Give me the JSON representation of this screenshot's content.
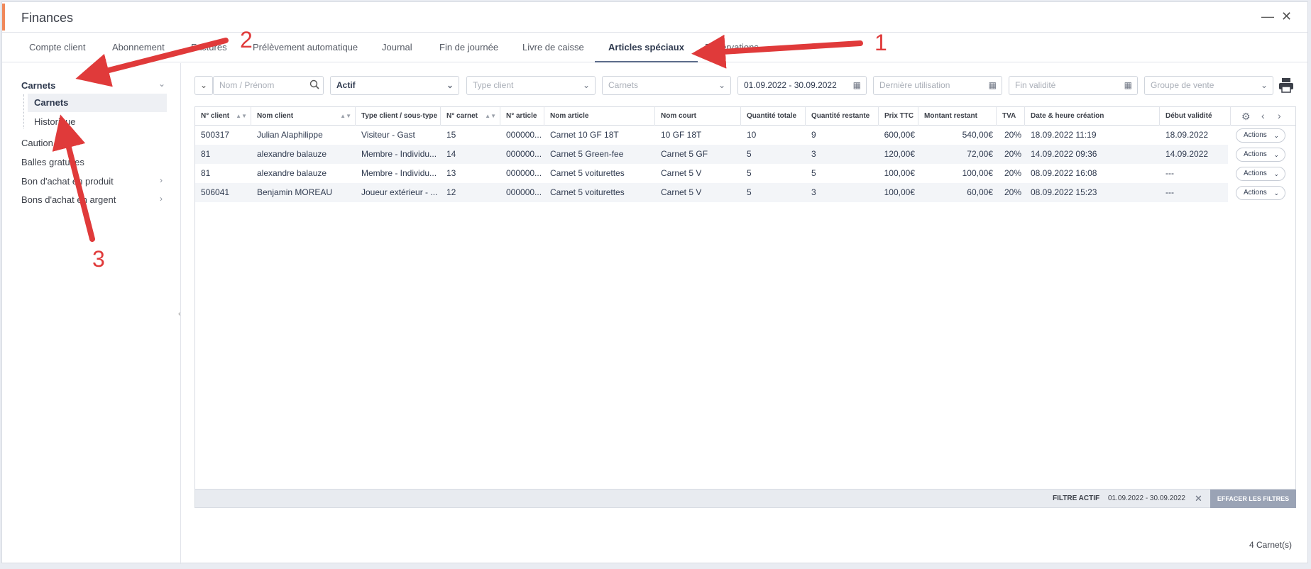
{
  "window": {
    "title": "Finances",
    "minimize_glyph": "—",
    "close_glyph": "✕"
  },
  "tabs": [
    {
      "label": "Compte client"
    },
    {
      "label": "Abonnement"
    },
    {
      "label": "Factures"
    },
    {
      "label": "Prélèvement automatique"
    },
    {
      "label": "Journal"
    },
    {
      "label": "Fin de journée"
    },
    {
      "label": "Livre de caisse"
    },
    {
      "label": "Articles spéciaux",
      "active": true
    },
    {
      "label": "Réservations"
    }
  ],
  "sidebar": {
    "group": "Carnets",
    "sub_items": [
      "Carnets",
      "Historique"
    ],
    "items": [
      "Caution",
      "Balles gratuites",
      "Bon d'achat en produit",
      "Bons d'achat en argent"
    ]
  },
  "filters": {
    "name_placeholder": "Nom / Prénom",
    "status": "Actif",
    "client_type_placeholder": "Type client",
    "carnets_placeholder": "Carnets",
    "date_range": "01.09.2022 - 30.09.2022",
    "last_use_placeholder": "Dernière utilisation",
    "validity_end_placeholder": "Fin validité",
    "sales_group_placeholder": "Groupe de vente"
  },
  "table": {
    "columns": [
      "N° client",
      "Nom client",
      "Type client / sous-type",
      "N° carnet",
      "N° article",
      "Nom article",
      "Nom court",
      "Quantité totale",
      "Quantité restante",
      "Prix TTC",
      "Montant restant",
      "TVA",
      "Date & heure création",
      "Début validité"
    ],
    "rows": [
      [
        "500317",
        "Julian Alaphilippe",
        "Visiteur - Gast",
        "15",
        "000000...",
        "Carnet 10 GF 18T",
        "10 GF 18T",
        "10",
        "9",
        "600,00€",
        "540,00€",
        "20%",
        "18.09.2022 11:19",
        "18.09.2022"
      ],
      [
        "81",
        "alexandre balauze",
        "Membre - Individu...",
        "14",
        "000000...",
        "Carnet 5 Green-fee",
        "Carnet 5 GF",
        "5",
        "3",
        "120,00€",
        "72,00€",
        "20%",
        "14.09.2022 09:36",
        "14.09.2022"
      ],
      [
        "81",
        "alexandre balauze",
        "Membre - Individu...",
        "13",
        "000000...",
        "Carnet 5 voiturettes",
        "Carnet 5 V",
        "5",
        "5",
        "100,00€",
        "100,00€",
        "20%",
        "08.09.2022 16:08",
        "---"
      ],
      [
        "506041",
        "Benjamin MOREAU",
        "Joueur extérieur - ...",
        "12",
        "000000...",
        "Carnet 5 voiturettes",
        "Carnet 5 V",
        "5",
        "3",
        "100,00€",
        "60,00€",
        "20%",
        "08.09.2022 15:23",
        "---"
      ]
    ],
    "action_label": "Actions"
  },
  "footer": {
    "filter_label": "FILTRE ACTIF",
    "filter_value": "01.09.2022 - 30.09.2022",
    "clear_button": "EFFACER LES FILTRES"
  },
  "count_text": "4 Carnet(s)",
  "annotations": [
    "1",
    "2",
    "3"
  ],
  "colors": {
    "accent": "#f0885a",
    "arrow": "#e03a3a",
    "active_tab_underline": "#5b6b8a"
  }
}
